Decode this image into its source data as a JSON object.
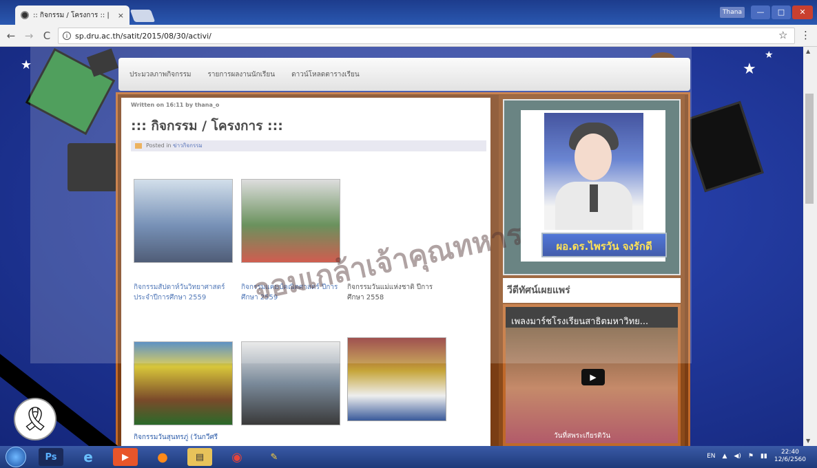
{
  "browser": {
    "tab_title": ":: กิจกรรม / โครงการ :: | ",
    "tab_close": "×",
    "url": "sp.dru.ac.th/satit/2015/08/30/activi/",
    "user": "Thana"
  },
  "site": {
    "nav": [
      "ประมวลภาพกิจกรรม",
      "รายการผลงานนักเรียน",
      "ดาวน์โหลดตารางเรียน"
    ],
    "meta": "Written on 16:11 by thana_o",
    "title": "::: กิจกรรม / โครงการ :::",
    "posted_label": "Posted in",
    "posted_link": "ข่าวกิจกรรม",
    "gallery": [
      {
        "caption": "กิจกรรมสัปดาห์วันวิทยาศาสตร์ ประจำปีการศึกษา 2559"
      },
      {
        "caption": "กิจกรรมแคมป์คณิตศาสตร์ ปีการศึกษา 2559"
      },
      {
        "caption": "กิจกรรมวันแม่แห่งชาติ ปีการศึกษา 2558"
      },
      {
        "caption": "กิจกรรมวันสุนทรภู่ (วันกวีศรี"
      },
      {
        "caption": ""
      },
      {
        "caption": ""
      }
    ]
  },
  "sidebar": {
    "name_plate": "ผอ.ดร.ไพรวัน จงรักดี",
    "video_header": "วีดีทัศน์เผยแพร่",
    "video_title": "เพลงมาร์ชโรงเรียนสาธิตมหาวิทย...",
    "video_caption": "วันที่สพระเกียรติวัน"
  },
  "watermark": "จอมเกล้าเจ้าคุณทหาร",
  "taskbar": {
    "apps": [
      "Ps",
      "e",
      "▶",
      "●",
      "▤",
      "◉",
      "✎"
    ],
    "lang": "EN",
    "time": "22:40",
    "date": "12/6/2560"
  }
}
